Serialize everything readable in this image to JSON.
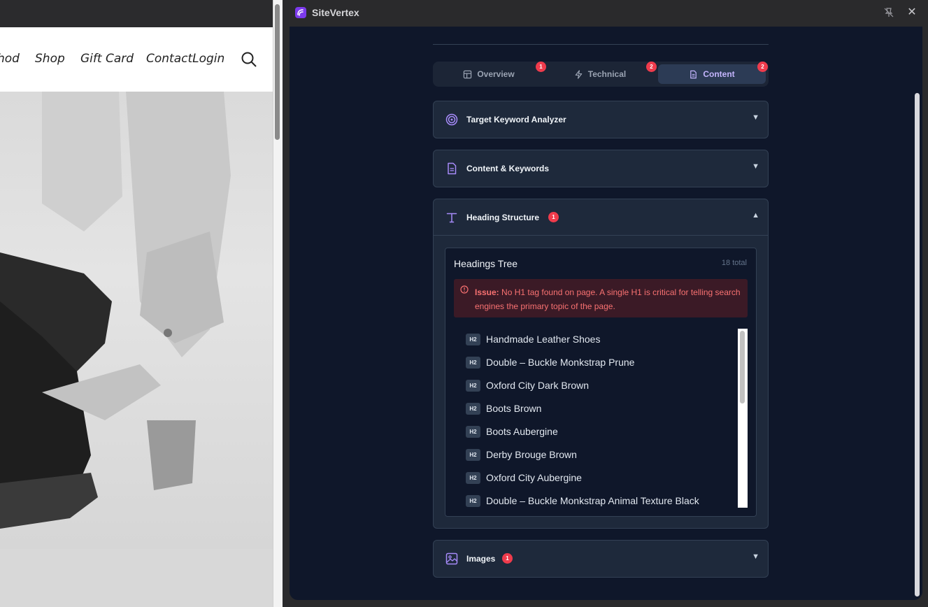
{
  "site": {
    "nav": [
      "hod",
      "Shop",
      "Gift Card",
      "ContactLogin"
    ]
  },
  "panel": {
    "title": "SiteVertex",
    "tabs": [
      {
        "label": "Overview",
        "badge": "1"
      },
      {
        "label": "Technical",
        "badge": "2"
      },
      {
        "label": "Content",
        "badge": "2",
        "active": true
      }
    ],
    "sections": {
      "keyword": {
        "title": "Target Keyword Analyzer",
        "chevron": "▼"
      },
      "content": {
        "title": "Content & Keywords",
        "chevron": "▼"
      },
      "headings": {
        "title": "Heading Structure",
        "badge": "1",
        "chevron": "▲"
      },
      "images": {
        "title": "Images",
        "badge": "1",
        "chevron": "▼"
      }
    },
    "headings_tree": {
      "title": "Headings Tree",
      "count": "18 total",
      "issue_label": "Issue:",
      "issue_text": "No H1 tag found on page. A single H1 is critical for telling search engines the primary topic of the page.",
      "items": [
        {
          "tag": "H2",
          "text": "Handmade Leather Shoes"
        },
        {
          "tag": "H2",
          "text": "Double – Buckle Monkstrap Prune"
        },
        {
          "tag": "H2",
          "text": "Oxford City Dark Brown"
        },
        {
          "tag": "H2",
          "text": "Boots Brown"
        },
        {
          "tag": "H2",
          "text": "Boots Aubergine"
        },
        {
          "tag": "H2",
          "text": "Derby Brouge Brown"
        },
        {
          "tag": "H2",
          "text": "Oxford City Aubergine"
        },
        {
          "tag": "H2",
          "text": "Double – Buckle Monkstrap Animal Texture Black"
        }
      ]
    },
    "colors": {
      "accent": "#c4b5fd",
      "badge": "#ef3b4c",
      "issue": "#f87171"
    }
  }
}
